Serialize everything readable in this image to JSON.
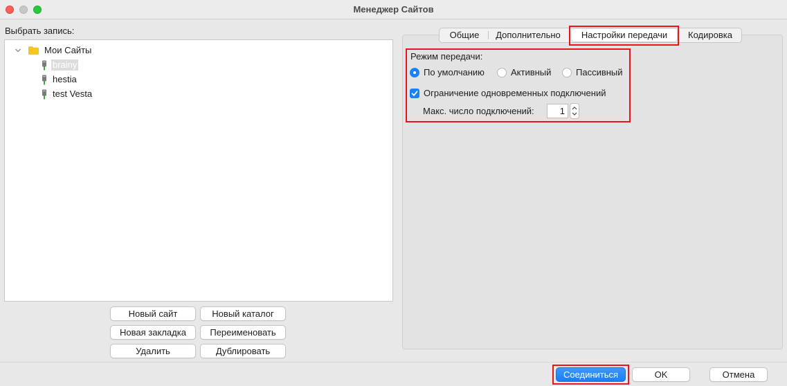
{
  "window": {
    "title": "Менеджер Сайтов"
  },
  "left": {
    "select_label": "Выбрать запись:",
    "tree": {
      "root": "Мои Сайты",
      "items": [
        "brainy",
        "hestia",
        "test Vesta"
      ]
    },
    "buttons": {
      "new_site": "Новый сайт",
      "new_folder": "Новый каталог",
      "new_bookmark": "Новая закладка",
      "rename": "Переименовать",
      "delete": "Удалить",
      "duplicate": "Дублировать"
    }
  },
  "tabs": [
    "Общие",
    "Дополнительно",
    "Настройки передачи",
    "Кодировка"
  ],
  "transfer": {
    "mode_label": "Режим передачи:",
    "options": [
      "По умолчанию",
      "Активный",
      "Пассивный"
    ],
    "limit_label": "Ограничение одновременных подключений",
    "max_label": "Макс. число подключений:",
    "max_value": "1"
  },
  "footer": {
    "connect": "Соединиться",
    "ok": "OK",
    "cancel": "Отмена"
  },
  "colors": {
    "accent": "#1a82fb",
    "highlight": "#e8141c"
  }
}
